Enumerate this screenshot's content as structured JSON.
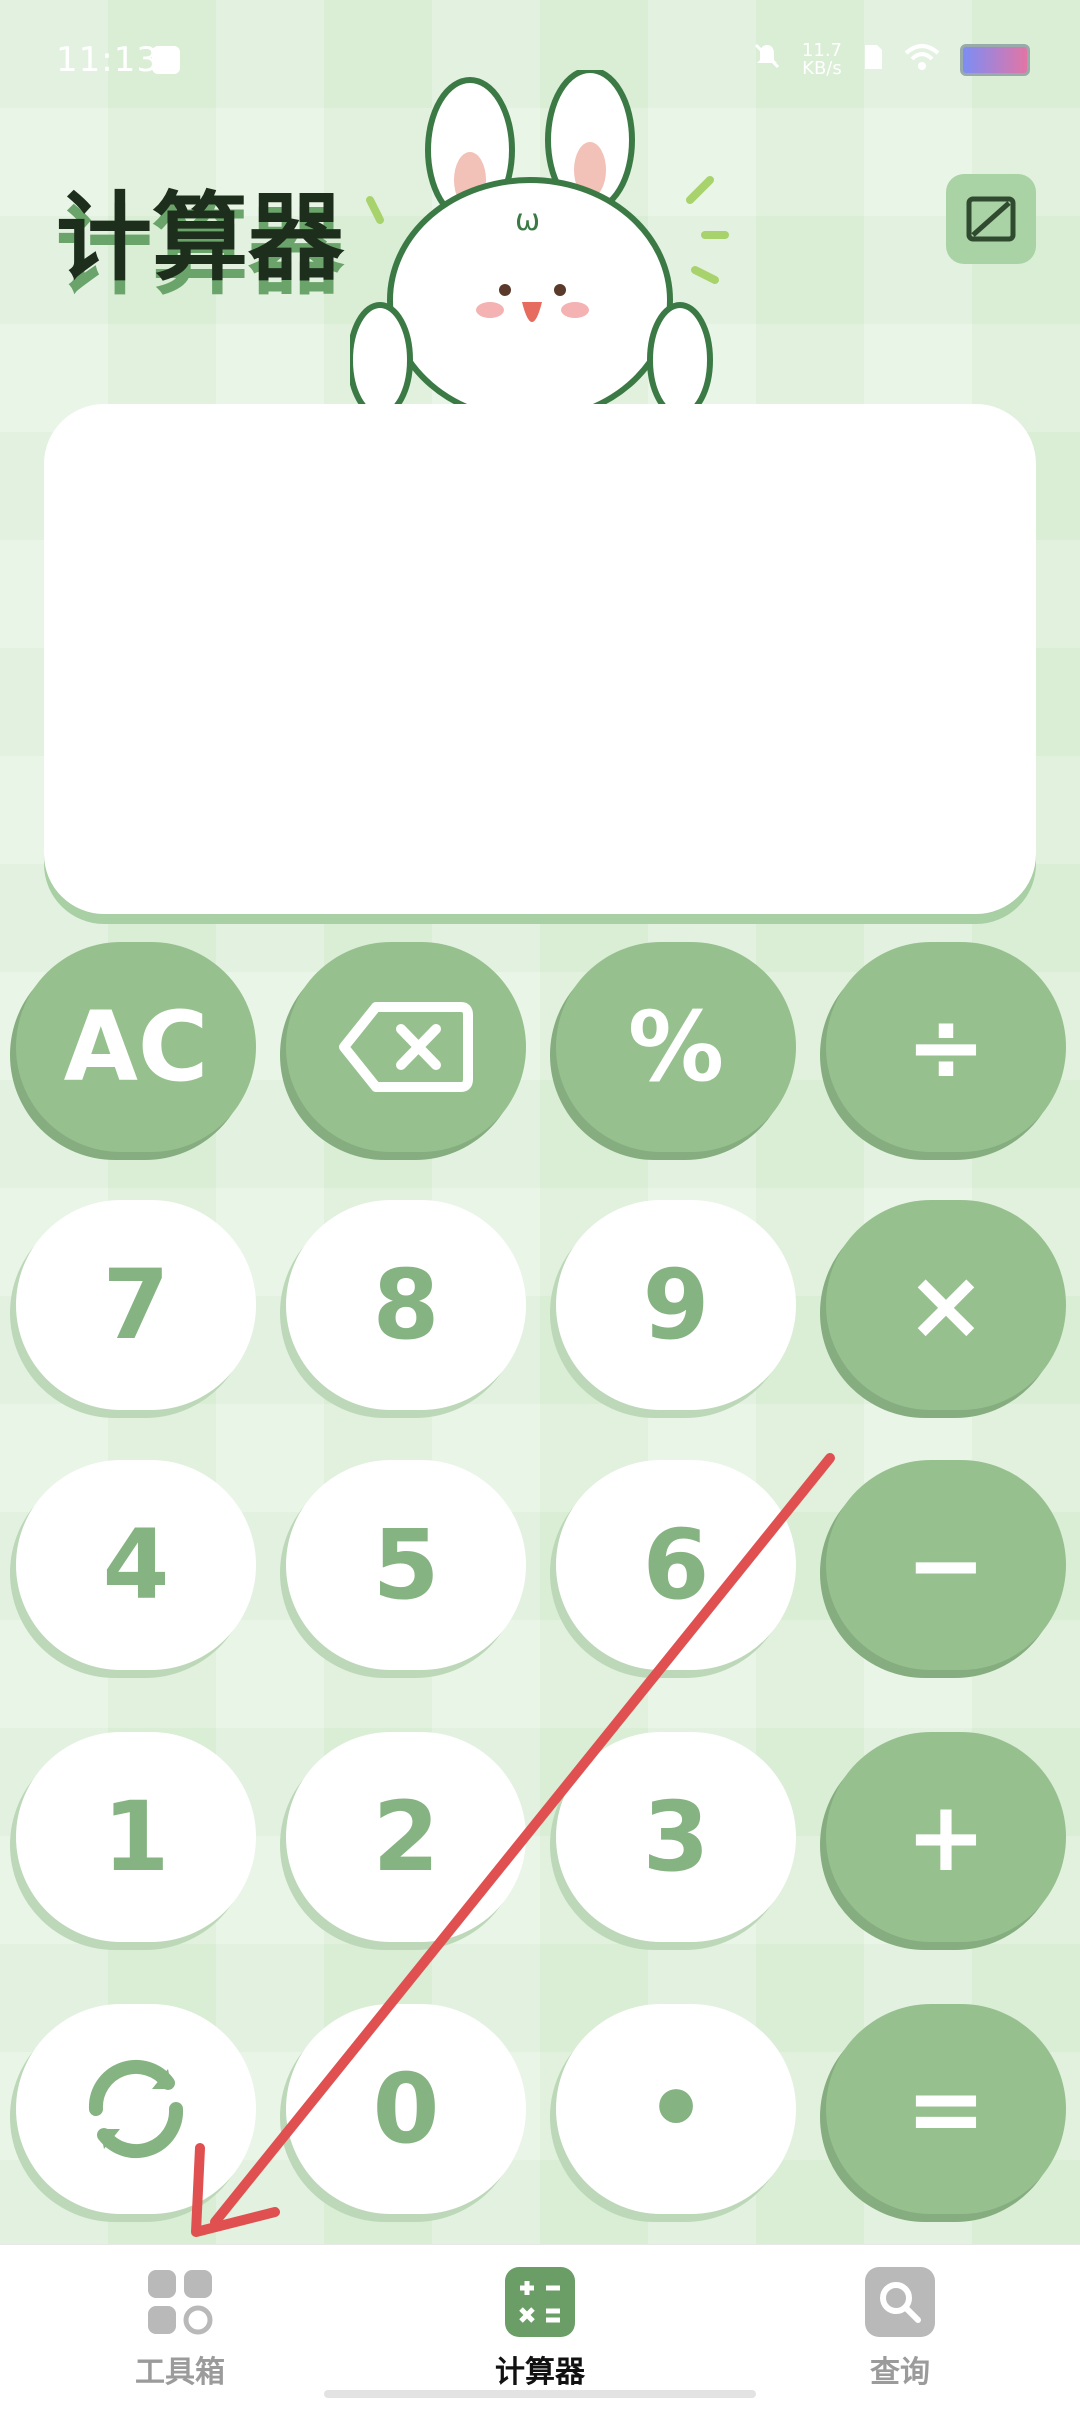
{
  "status_bar": {
    "time": "11:13",
    "net_speed": "11.7",
    "net_unit": "KB/s"
  },
  "header": {
    "title": "计算器"
  },
  "display": {
    "value": ""
  },
  "keys": {
    "ac": "AC",
    "backspace": "⌫",
    "percent": "%",
    "divide": "÷",
    "seven": "7",
    "eight": "8",
    "nine": "9",
    "multiply": "×",
    "four": "4",
    "five": "5",
    "six": "6",
    "minus": "−",
    "one": "1",
    "two": "2",
    "three": "3",
    "plus": "+",
    "switch": "↻",
    "zero": "0",
    "dot": "•",
    "equals": "="
  },
  "bottom_nav": {
    "items": [
      {
        "label": "工具箱",
        "icon": "toolbox-icon"
      },
      {
        "label": "计算器",
        "icon": "calculator-icon"
      },
      {
        "label": "查询",
        "icon": "search-icon"
      }
    ]
  },
  "colors": {
    "accent": "#97c08f",
    "key_text": "#86b382",
    "arrow": "#e05050"
  }
}
